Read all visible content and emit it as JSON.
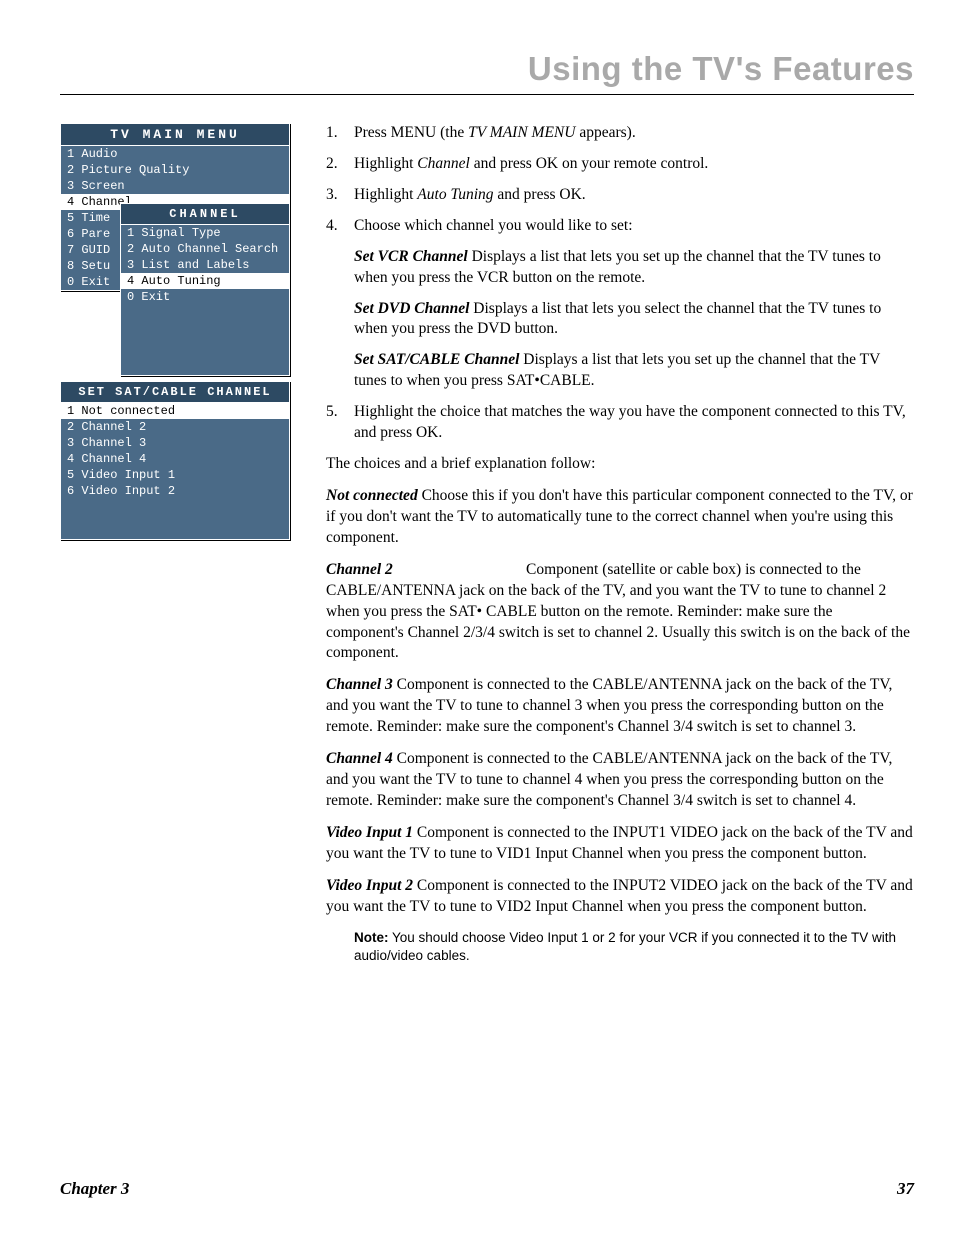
{
  "header": {
    "title": "Using the TV's Features"
  },
  "osd_main": {
    "title": "TV MAIN MENU",
    "items": [
      {
        "n": "1",
        "label": "Audio"
      },
      {
        "n": "2",
        "label": "Picture Quality"
      },
      {
        "n": "3",
        "label": "Screen"
      },
      {
        "n": "4",
        "label": "Channel",
        "selected": true
      },
      {
        "n": "5",
        "label": "Time"
      },
      {
        "n": "6",
        "label": "Pare"
      },
      {
        "n": "7",
        "label": "GUID"
      },
      {
        "n": "8",
        "label": "Setu"
      },
      {
        "n": "0",
        "label": "Exit"
      }
    ]
  },
  "osd_sub": {
    "title": "CHANNEL",
    "items": [
      {
        "n": "1",
        "label": "Signal Type"
      },
      {
        "n": "2",
        "label": "Auto Channel Search"
      },
      {
        "n": "3",
        "label": "List and Labels"
      },
      {
        "n": "4",
        "label": "Auto Tuning",
        "selected": true
      },
      {
        "n": "0",
        "label": "Exit"
      }
    ]
  },
  "osd_sat": {
    "title": "SET SAT/CABLE CHANNEL",
    "items": [
      {
        "n": "1",
        "label": "Not connected",
        "selected": true
      },
      {
        "n": "2",
        "label": "Channel 2"
      },
      {
        "n": "3",
        "label": "Channel 3"
      },
      {
        "n": "4",
        "label": "Channel 4"
      },
      {
        "n": "5",
        "label": "Video Input 1"
      },
      {
        "n": "6",
        "label": "Video Input 2"
      }
    ]
  },
  "steps": {
    "s1_a": "Press MENU (the ",
    "s1_i": "TV MAIN MENU",
    "s1_b": " appears).",
    "s2_a": "Highlight ",
    "s2_i": "Channel",
    "s2_b": " and press OK on your remote control.",
    "s3_a": "Highlight ",
    "s3_i": "Auto Tuning",
    "s3_b": " and press OK.",
    "s4": "Choose which channel you would like to set:",
    "vcr_t": "Set VCR Channel",
    "vcr_d": "   Displays a list that lets you set up the channel that the TV tunes to when you press the VCR button on the remote.",
    "dvd_t": "Set DVD Channel",
    "dvd_d": "   Displays a list that lets you select the channel that the TV tunes to when you press the DVD button.",
    "sat_t": "Set SAT/CABLE Channel",
    "sat_d": "   Displays a list that lets you set up the channel that the TV tunes to when you press SAT•CABLE.",
    "s5": "Highlight the choice that matches the way you have the component connected to this TV, and press OK."
  },
  "body": {
    "intro": "The choices and a brief explanation follow:",
    "nc_t": "Not connected",
    "nc_d": "   Choose this if you don't have this particular component connected to the TV, or if you don't want the TV to automatically tune to the correct channel when you're using this component.",
    "c2_t": "Channel 2",
    "c2_d": "Component (satellite or cable box) is connected to the CABLE/ANTENNA jack on the back of the TV, and you want the TV to tune to channel 2 when you press the SAT• CABLE button on the remote. Reminder: make sure the component's Channel 2/3/4 switch is set to channel 2. Usually this switch is on the back of the component.",
    "c3_t": "Channel 3",
    "c3_d": "   Component is connected to the CABLE/ANTENNA jack on the back of the TV, and you want the TV to tune to channel 3 when you press the corresponding button on the remote. Reminder: make sure the component's Channel 3/4 switch is set to channel 3.",
    "c4_t": "Channel 4",
    "c4_d": "    Component is connected to the CABLE/ANTENNA jack on the back of the TV, and you want the TV to tune to channel 4 when you press the corresponding button on the remote. Reminder: make sure the component's Channel 3/4 switch is set to channel 4.",
    "v1_t": "Video Input 1",
    "v1_d": "    Component is connected to the INPUT1 VIDEO jack on the back of the TV and you want the TV to tune to VID1 Input Channel when you press the component button.",
    "v2_t": "Video Input 2",
    "v2_d": "    Component is connected to the INPUT2 VIDEO jack on the back of the TV and you want the TV to tune to VID2 Input Channel when you press the component button.",
    "note_t": "Note:",
    "note_d": " You should choose Video Input 1 or 2  for your VCR if you connected it to the TV with audio/video cables."
  },
  "footer": {
    "chapter": "Chapter 3",
    "page": "37"
  }
}
